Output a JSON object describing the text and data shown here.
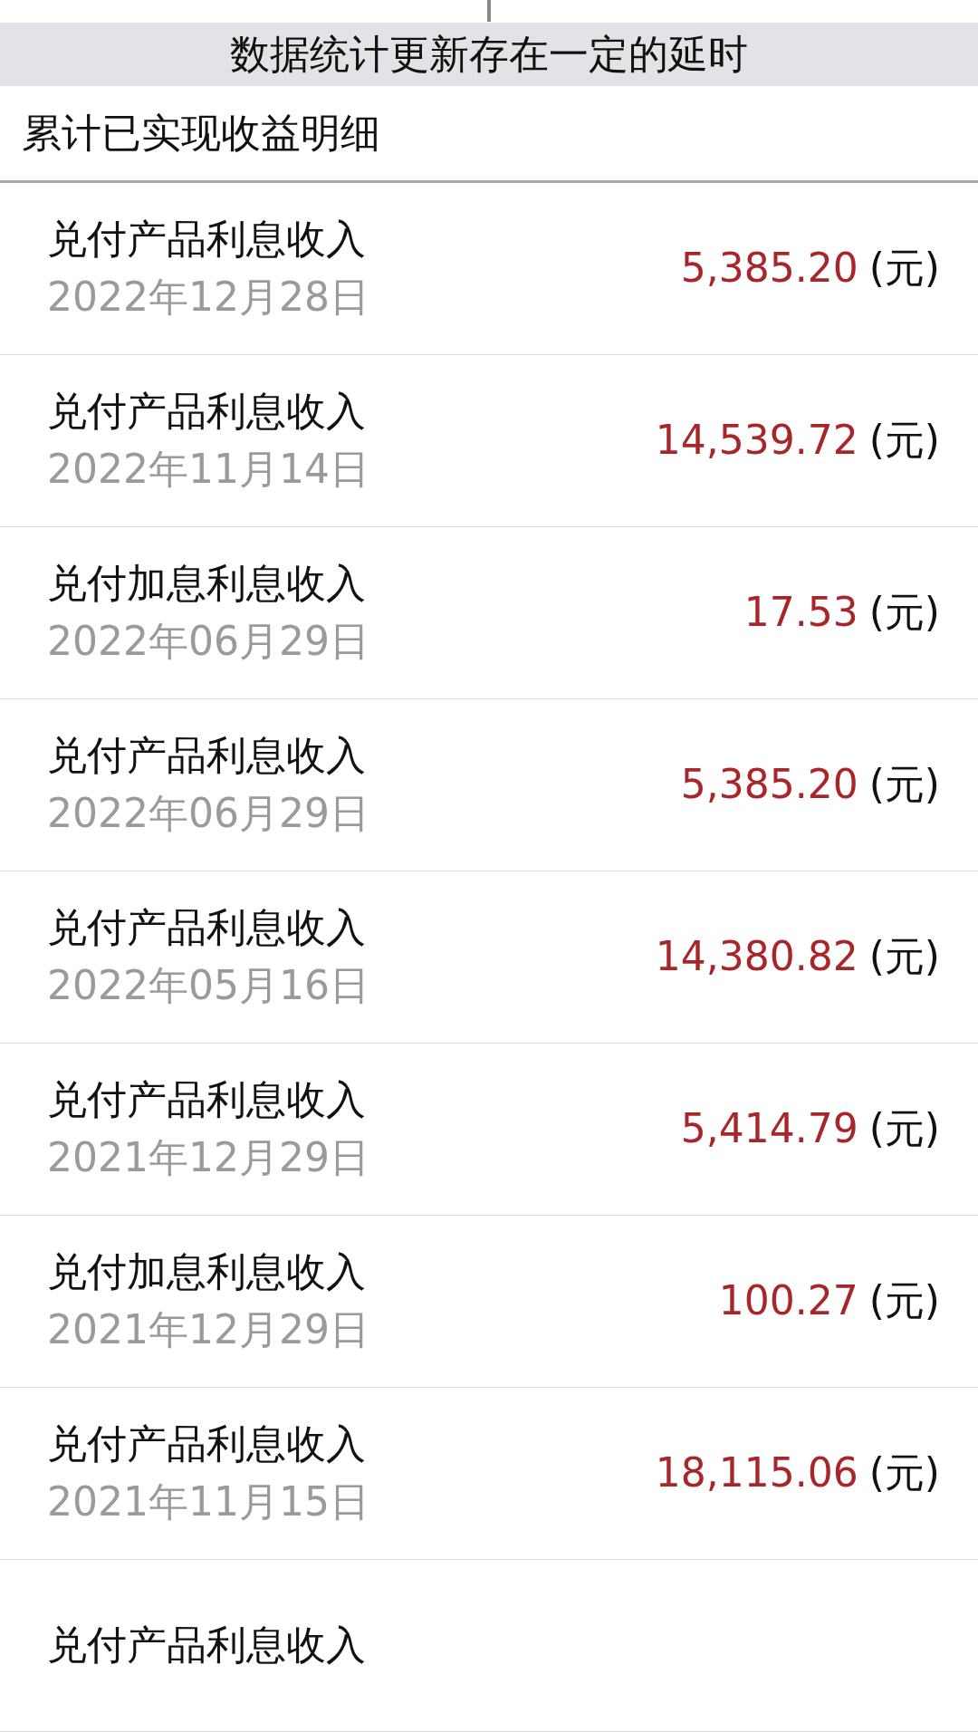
{
  "notice": "数据统计更新存在一定的延时",
  "section_title": "累计已实现收益明细",
  "records": [
    {
      "title": "兑付产品利息收入",
      "date": "2022年12月28日",
      "amount": "5,385.20",
      "unit": "(元)"
    },
    {
      "title": "兑付产品利息收入",
      "date": "2022年11月14日",
      "amount": "14,539.72",
      "unit": "(元)"
    },
    {
      "title": "兑付加息利息收入",
      "date": "2022年06月29日",
      "amount": "17.53",
      "unit": "(元)"
    },
    {
      "title": "兑付产品利息收入",
      "date": "2022年06月29日",
      "amount": "5,385.20",
      "unit": "(元)"
    },
    {
      "title": "兑付产品利息收入",
      "date": "2022年05月16日",
      "amount": "14,380.82",
      "unit": "(元)"
    },
    {
      "title": "兑付产品利息收入",
      "date": "2021年12月29日",
      "amount": "5,414.79",
      "unit": "(元)"
    },
    {
      "title": "兑付加息利息收入",
      "date": "2021年12月29日",
      "amount": "100.27",
      "unit": "(元)"
    },
    {
      "title": "兑付产品利息收入",
      "date": "2021年11月15日",
      "amount": "18,115.06",
      "unit": "(元)"
    },
    {
      "title": "兑付产品利息收入"
    }
  ]
}
